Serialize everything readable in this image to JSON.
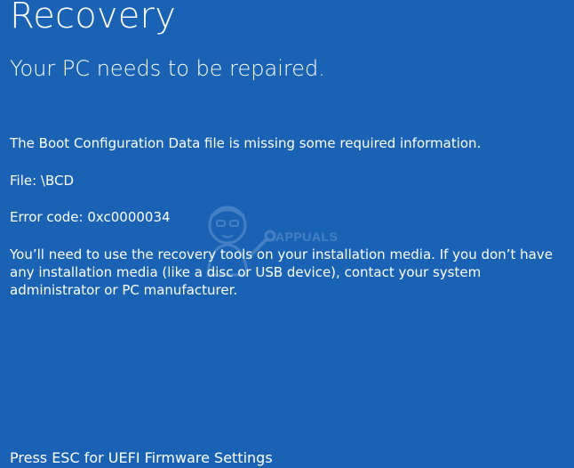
{
  "screen": {
    "title": "Recovery",
    "subtitle": "Your PC needs to be repaired.",
    "background_color": "#1a63b4",
    "description": "The Boot Configuration Data file is missing some required information.",
    "file_line": "File: \\BCD",
    "error_code_line": "Error code: 0xc0000034",
    "message": "You’ll need to use the recovery tools on your installation media. If you don’t have any installation media (like a disc or USB device), contact your system administrator or PC manufacturer.",
    "footer": "Press ESC for UEFI Firmware Settings"
  },
  "watermark": {
    "text": "APPUALS",
    "icon": "mascot-watermark-icon"
  }
}
